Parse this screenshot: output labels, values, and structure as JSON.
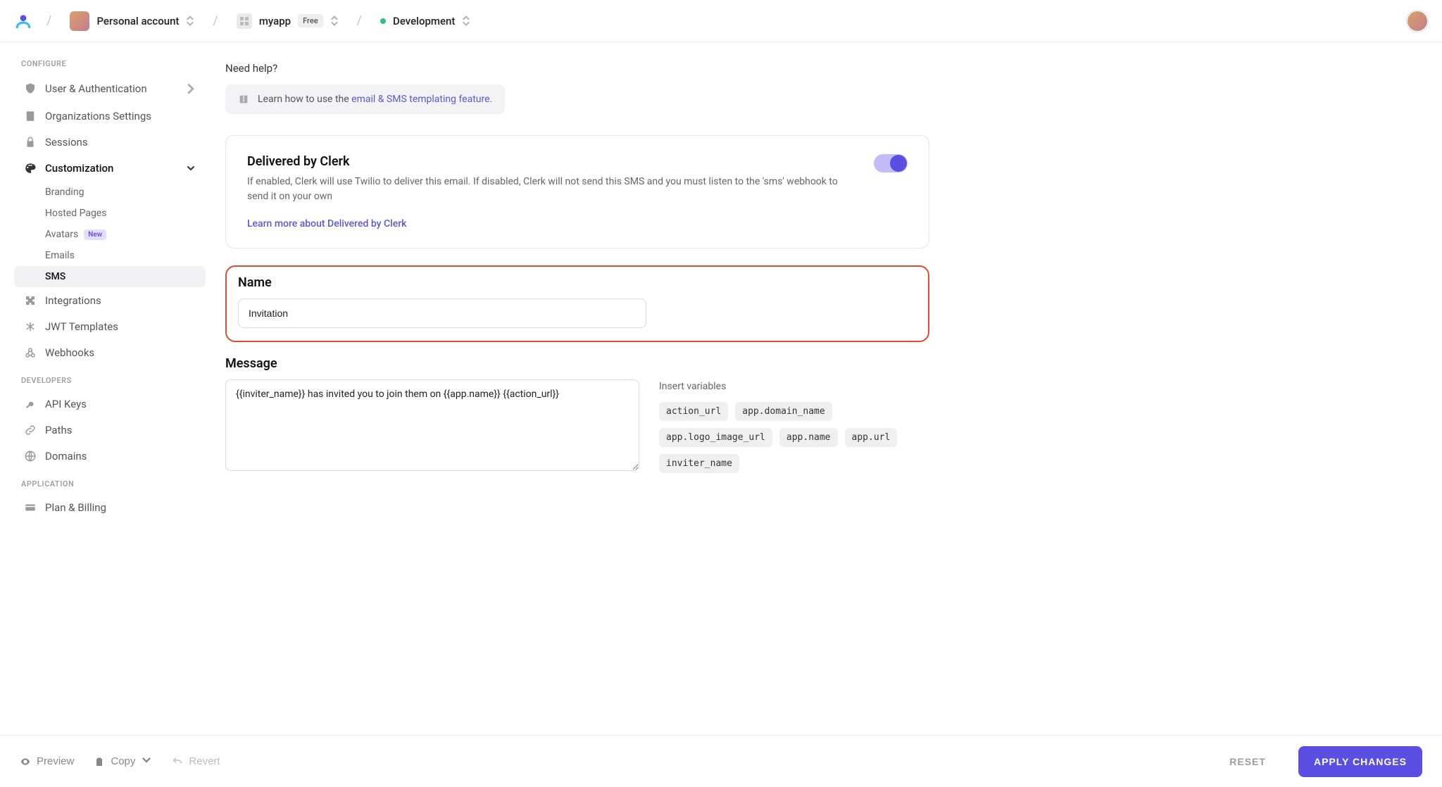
{
  "breadcrumb": {
    "account_label": "Personal account",
    "app_name": "myapp",
    "app_plan": "Free",
    "env_name": "Development"
  },
  "sidebar": {
    "configure_header": "CONFIGURE",
    "developers_header": "DEVELOPERS",
    "application_header": "APPLICATION",
    "items": {
      "user_auth": "User & Authentication",
      "orgs": "Organizations Settings",
      "sessions": "Sessions",
      "customization": "Customization",
      "integrations": "Integrations",
      "jwt": "JWT Templates",
      "webhooks": "Webhooks",
      "api_keys": "API Keys",
      "paths": "Paths",
      "domains": "Domains",
      "plan_billing": "Plan & Billing"
    },
    "sub": {
      "branding": "Branding",
      "hosted": "Hosted Pages",
      "avatars": "Avatars",
      "avatars_badge": "New",
      "emails": "Emails",
      "sms": "SMS"
    }
  },
  "main": {
    "need_help": "Need help?",
    "help_prefix": "Learn how to use the ",
    "help_link": "email & SMS templating feature",
    "help_suffix": ".",
    "card": {
      "title": "Delivered by Clerk",
      "desc": "If enabled, Clerk will use Twilio to deliver this email. If disabled, Clerk will not send this SMS and you must listen to the 'sms' webhook to send it on your own",
      "link": "Learn more about Delivered by Clerk",
      "toggle_on": true
    },
    "name_label": "Name",
    "name_value": "Invitation",
    "message_label": "Message",
    "message_value": "{{inviter_name}} has invited you to join them on {{app.name}} {{action_url}}",
    "vars_label": "Insert variables",
    "vars": [
      "action_url",
      "app.domain_name",
      "app.logo_image_url",
      "app.name",
      "app.url",
      "inviter_name"
    ]
  },
  "footer": {
    "preview": "Preview",
    "copy": "Copy",
    "revert": "Revert",
    "reset": "RESET",
    "apply": "APPLY CHANGES"
  }
}
